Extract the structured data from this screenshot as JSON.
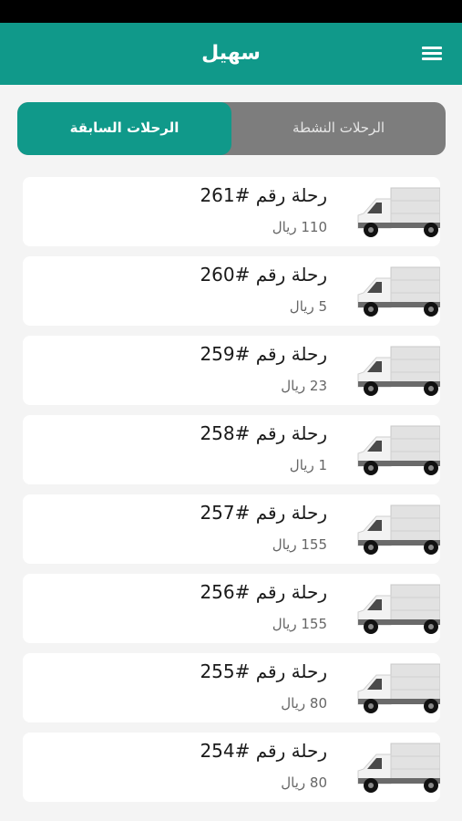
{
  "app": {
    "title": "سهيل"
  },
  "header": {
    "menu_icon": "hamburger-menu-icon"
  },
  "tabs": [
    {
      "label": "الرحلات السابقة",
      "selected": true
    },
    {
      "label": "الرحلات النشطة",
      "selected": false
    }
  ],
  "colors": {
    "primary": "#10998a",
    "tab_inactive": "#7d7d7d",
    "background": "#f4f4f4"
  },
  "trips": [
    {
      "title": "رحلة رقم #261",
      "price": "110 ريال",
      "icon": "truck-icon"
    },
    {
      "title": "رحلة رقم #260",
      "price": "5 ريال",
      "icon": "truck-icon"
    },
    {
      "title": "رحلة رقم #259",
      "price": "23 ريال",
      "icon": "truck-icon"
    },
    {
      "title": "رحلة رقم #258",
      "price": "1 ريال",
      "icon": "truck-icon"
    },
    {
      "title": "رحلة رقم #257",
      "price": "155 ريال",
      "icon": "truck-icon"
    },
    {
      "title": "رحلة رقم #256",
      "price": "155 ريال",
      "icon": "truck-icon"
    },
    {
      "title": "رحلة رقم #255",
      "price": "80 ريال",
      "icon": "truck-icon"
    },
    {
      "title": "رحلة رقم #254",
      "price": "80 ريال",
      "icon": "truck-icon"
    }
  ]
}
